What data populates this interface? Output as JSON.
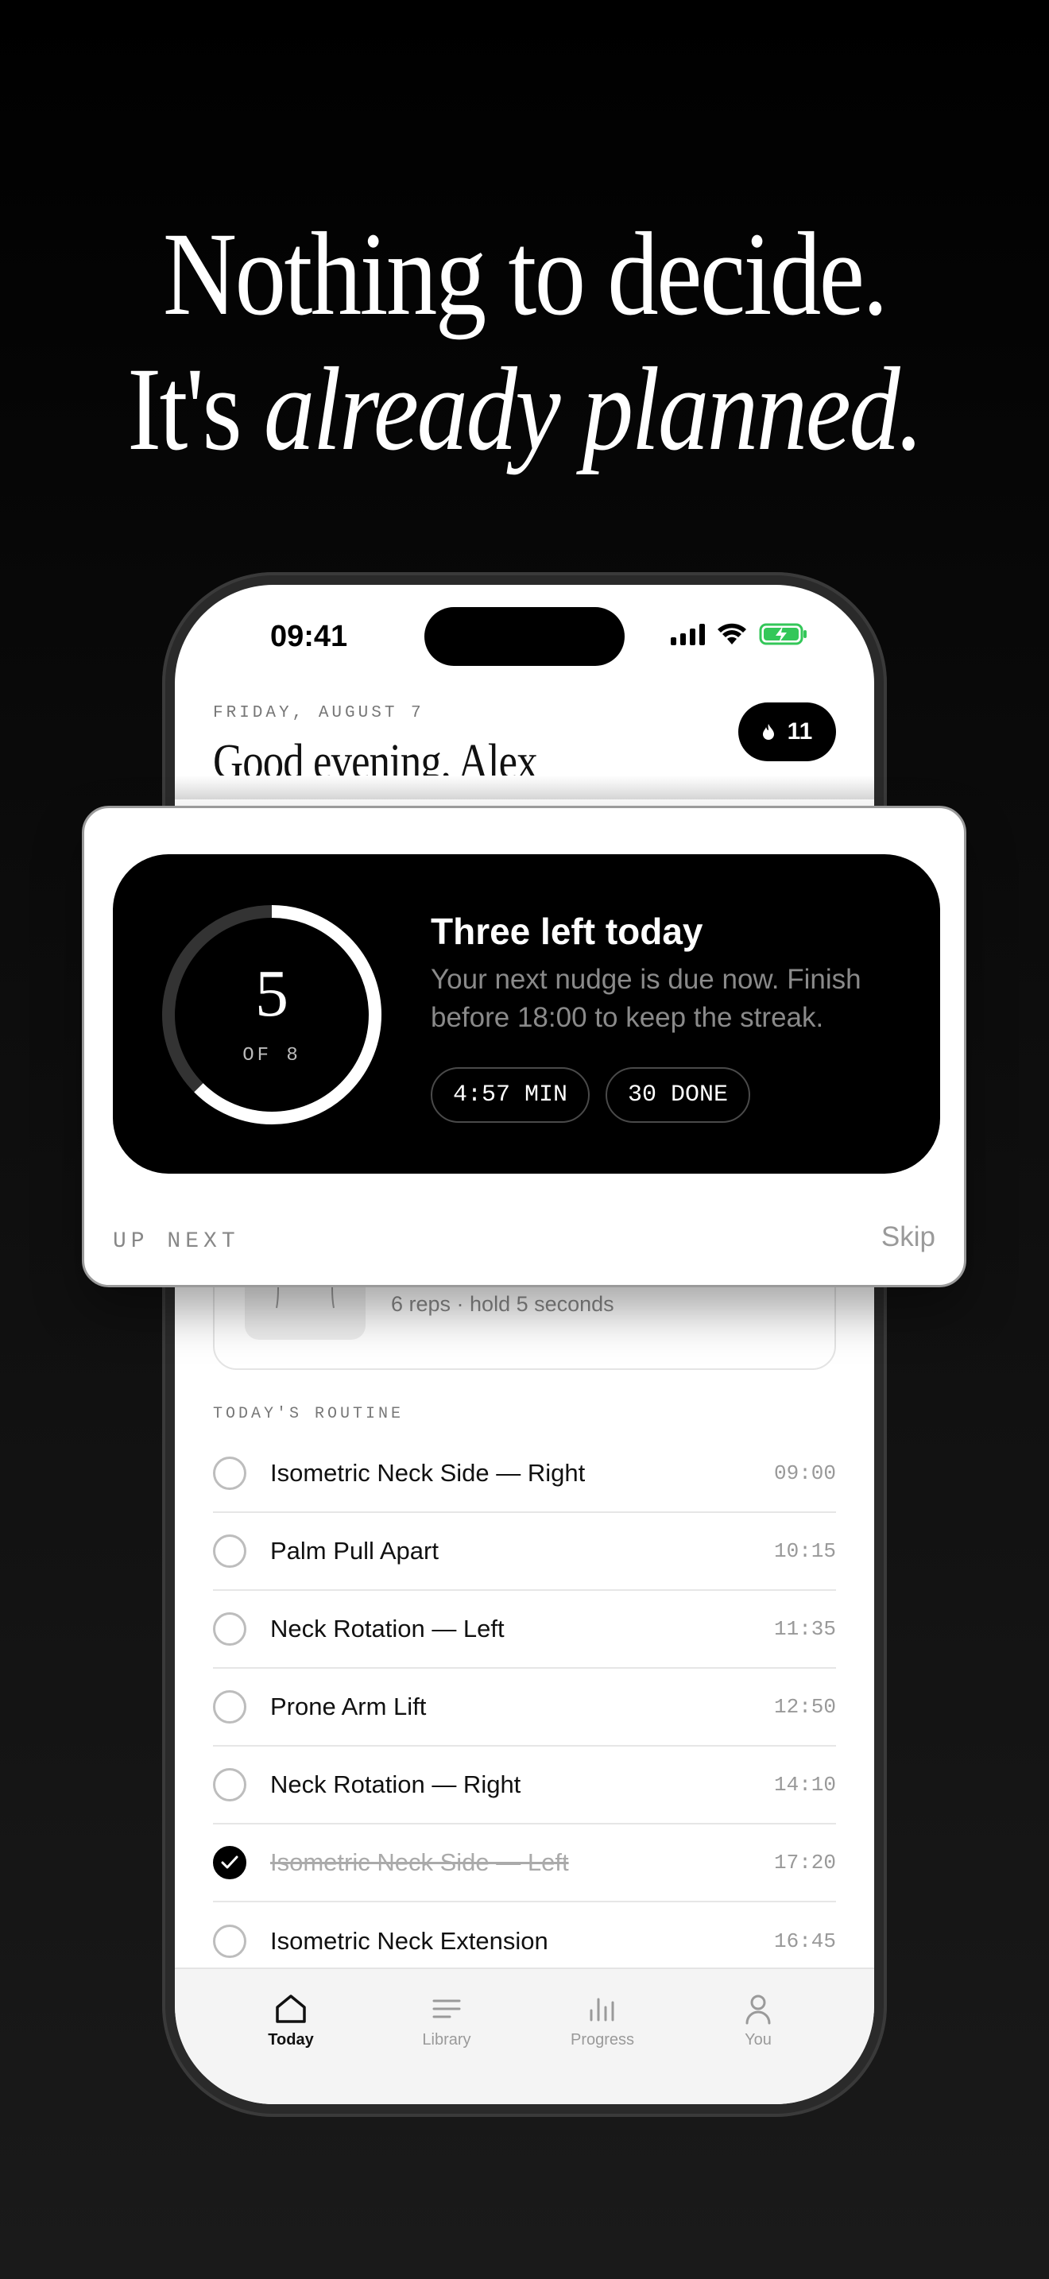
{
  "headline": {
    "line1": "Nothing to decide.",
    "line2_prefix": "It's ",
    "line2_emphasis": "already planned."
  },
  "status_bar": {
    "time": "09:41"
  },
  "header": {
    "date": "FRIDAY, AUGUST 7",
    "greeting": "Good evening, Alex",
    "streak_count": "11",
    "streak_icon": "flame-icon"
  },
  "widget": {
    "ring_progress": 0.625,
    "ring_value": "5",
    "ring_caption": "OF 8",
    "title": "Three left today",
    "body": "Your next nudge is due now. Finish before 18:00 to keep the streak.",
    "chips": [
      "4:57 MIN",
      "30 DONE"
    ],
    "up_next_label": "UP NEXT",
    "skip_label": "Skip"
  },
  "up_next_card": {
    "subtitle": "6 reps · hold 5 seconds"
  },
  "routine": {
    "label": "TODAY'S ROUTINE",
    "items": [
      {
        "name": "Isometric Neck Side — Right",
        "time": "09:00",
        "done": false
      },
      {
        "name": "Palm Pull Apart",
        "time": "10:15",
        "done": false
      },
      {
        "name": "Neck Rotation — Left",
        "time": "11:35",
        "done": false
      },
      {
        "name": "Prone Arm Lift",
        "time": "12:50",
        "done": false
      },
      {
        "name": "Neck Rotation — Right",
        "time": "14:10",
        "done": false
      },
      {
        "name": "Isometric Neck Side — Left",
        "time": "17:20",
        "done": true
      },
      {
        "name": "Isometric Neck Extension",
        "time": "16:45",
        "done": false
      }
    ]
  },
  "tabs": [
    {
      "label": "Today",
      "icon": "home-icon",
      "active": true
    },
    {
      "label": "Library",
      "icon": "list-icon",
      "active": false
    },
    {
      "label": "Progress",
      "icon": "bar-chart-icon",
      "active": false
    },
    {
      "label": "You",
      "icon": "person-icon",
      "active": false
    }
  ],
  "colors": {
    "background": "#000000",
    "accent": "#000000",
    "battery_charging": "#34c759",
    "muted_text": "#8a8a8a"
  }
}
